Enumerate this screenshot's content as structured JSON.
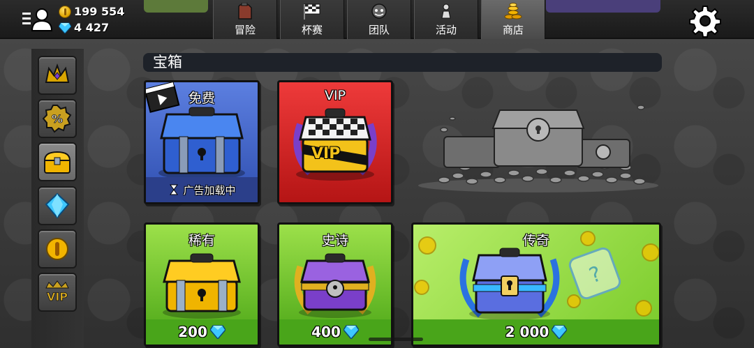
{
  "header": {
    "coins": "199 554",
    "gems": "4 427",
    "tabs": [
      {
        "label": "冒险",
        "icon": "gas-can-icon"
      },
      {
        "label": "杯赛",
        "icon": "checkered-flag-icon"
      },
      {
        "label": "团队",
        "icon": "team-badge-icon"
      },
      {
        "label": "活动",
        "icon": "event-figure-icon"
      },
      {
        "label": "商店",
        "icon": "coin-stack-icon",
        "active": true
      }
    ]
  },
  "sidebar": {
    "items": [
      {
        "icon": "crown-icon"
      },
      {
        "icon": "discount-badge-icon"
      },
      {
        "icon": "chest-icon",
        "active": true
      },
      {
        "icon": "diamond-icon"
      },
      {
        "icon": "coin-icon"
      },
      {
        "icon": "vip-badge-icon"
      }
    ]
  },
  "section": {
    "title": "宝箱"
  },
  "chests": {
    "free": {
      "title": "免费",
      "status": "广告加载中"
    },
    "vip": {
      "title": "VIP",
      "badge": "VIP"
    },
    "rare": {
      "title": "稀有",
      "price": "200"
    },
    "epic": {
      "title": "史诗",
      "price": "400"
    },
    "legendary": {
      "title": "传奇",
      "price": "2 000"
    }
  },
  "colors": {
    "free_bg": "#3f63c8",
    "vip_bg": "#d01f1f",
    "green_bg": "#5fbf1e",
    "gem": "#3ec7ff",
    "coin": "#f2b400"
  }
}
